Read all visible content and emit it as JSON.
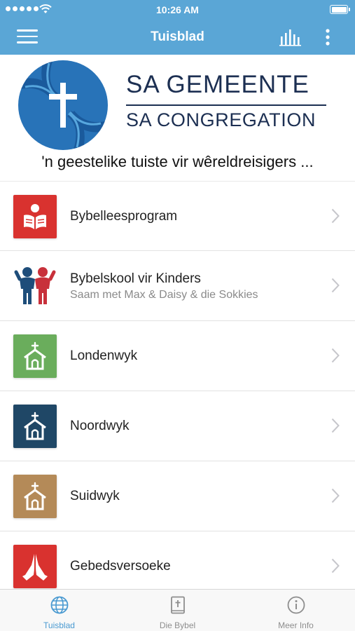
{
  "status": {
    "time": "10:26 AM"
  },
  "nav": {
    "title": "Tuisblad"
  },
  "header": {
    "brand_line1": "SA GEMEENTE",
    "brand_line2": "SA CONGREGATION",
    "tagline": "'n geestelike tuiste vir wêreldreisigers ..."
  },
  "colors": {
    "accent": "#5aa6d6",
    "tile_red": "#d9322f",
    "tile_green": "#6aad5c",
    "tile_navy": "#1f4766",
    "tile_tan": "#b48a58"
  },
  "items": [
    {
      "title": "Bybelleesprogram",
      "icon": "reading-person-icon"
    },
    {
      "title": "Bybelskool vir Kinders",
      "subtitle": "Saam met Max & Daisy & die Sokkies",
      "icon": "children-icon"
    },
    {
      "title": "Londenwyk",
      "icon": "church-icon"
    },
    {
      "title": "Noordwyk",
      "icon": "church-icon"
    },
    {
      "title": "Suidwyk",
      "icon": "church-icon"
    },
    {
      "title": "Gebedsversoeke",
      "icon": "praying-hands-icon"
    }
  ],
  "tabs": [
    {
      "label": "Tuisblad",
      "icon": "globe-icon",
      "active": true
    },
    {
      "label": "Die Bybel",
      "icon": "bible-icon",
      "active": false
    },
    {
      "label": "Meer Info",
      "icon": "info-icon",
      "active": false
    }
  ]
}
